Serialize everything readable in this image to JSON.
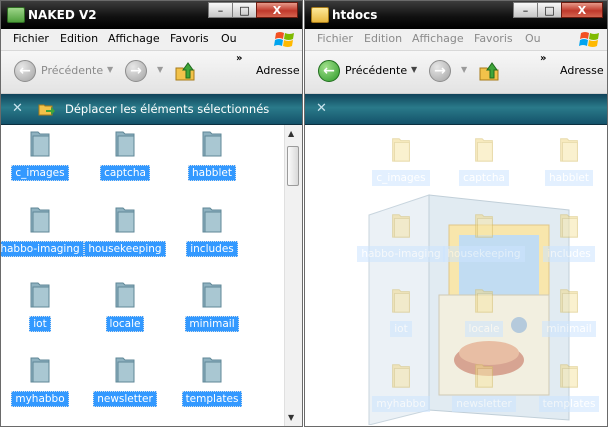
{
  "left_window": {
    "title": "NAKED V2",
    "caption": {
      "minimize": "–",
      "maximize": "□",
      "close": "X"
    },
    "menu": [
      "Fichier",
      "Edition",
      "Affichage",
      "Favoris",
      "Ou"
    ],
    "toolbar": {
      "back": "Précédente",
      "address": "Adresse",
      "overflow": "»"
    },
    "task": "Déplacer les éléments sélectionnés",
    "folders": [
      "c_images",
      "captcha",
      "habblet",
      "habbo-imaging",
      "housekeeping",
      "includes",
      "iot",
      "locale",
      "minimail",
      "myhabbo",
      "newsletter",
      "templates"
    ]
  },
  "right_window": {
    "title": "htdocs",
    "caption": {
      "minimize": "–",
      "maximize": "□",
      "close": "X"
    },
    "menu": [
      "Fichier",
      "Edition",
      "Affichage",
      "Favoris",
      "Ou"
    ],
    "toolbar": {
      "back": "Précédente",
      "address": "Adresse",
      "overflow": "»"
    },
    "ghost_folders": [
      "c_images",
      "captcha",
      "habblet",
      "habbo-imaging",
      "housekeeping",
      "includes",
      "iot",
      "locale",
      "minimail",
      "myhabbo",
      "newsletter",
      "templates"
    ]
  },
  "colors": {
    "selection": "#3399ff",
    "taskbar": "#1f6678",
    "close": "#c0392b"
  },
  "icons": {
    "folder": "folder-icon",
    "back": "back-arrow-icon",
    "forward": "forward-arrow-icon",
    "up": "folder-up-icon",
    "move": "move-items-icon",
    "windows": "windows-logo-icon"
  }
}
